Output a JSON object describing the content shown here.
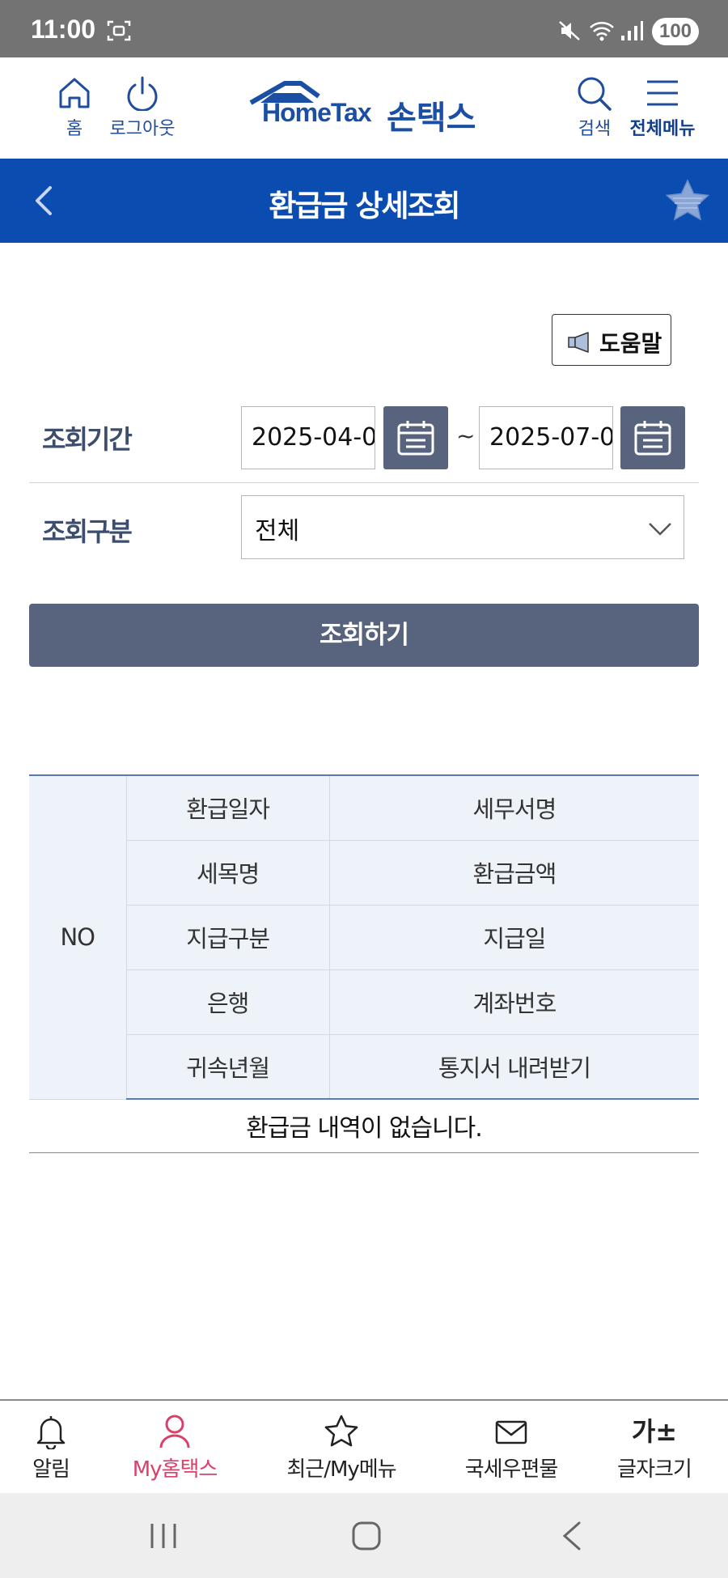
{
  "status_bar": {
    "time": "11:00",
    "battery": "100"
  },
  "header": {
    "home_label": "홈",
    "logout_label": "로그아웃",
    "logo_text": "HomeTax",
    "logo_korean": "손택스",
    "search_label": "검색",
    "menu_label": "전체메뉴"
  },
  "title_bar": {
    "title": "환급금 상세조회"
  },
  "help": {
    "label": "도움말"
  },
  "form": {
    "period_label": "조회기간",
    "start_date": "2025-04-0",
    "separator": "~",
    "end_date": "2025-07-0",
    "type_label": "조회구분",
    "type_value": "전체",
    "submit_label": "조회하기"
  },
  "table": {
    "no_header": "NO",
    "header_rows": [
      [
        "환급일자",
        "세무서명"
      ],
      [
        "세목명",
        "환급금액"
      ],
      [
        "지급구분",
        "지급일"
      ],
      [
        "은행",
        "계좌번호"
      ],
      [
        "귀속년월",
        "통지서 내려받기"
      ]
    ],
    "empty_message": "환급금 내역이 없습니다."
  },
  "bottom_nav": {
    "items": [
      {
        "label": "알림",
        "icon": "bell-icon"
      },
      {
        "label": "My홈택스",
        "icon": "person-icon"
      },
      {
        "label": "최근/My메뉴",
        "icon": "star-icon"
      },
      {
        "label": "국세우편물",
        "icon": "mail-icon"
      },
      {
        "label": "글자크기",
        "icon": "font-size-icon"
      }
    ],
    "font_glyph": "가±",
    "active_color": "#d9416a"
  },
  "colors": {
    "title_bar": "#0b4cb0",
    "button": "#58647d",
    "label": "#3c4d6e",
    "table_header_bg": "#eef3f9"
  }
}
